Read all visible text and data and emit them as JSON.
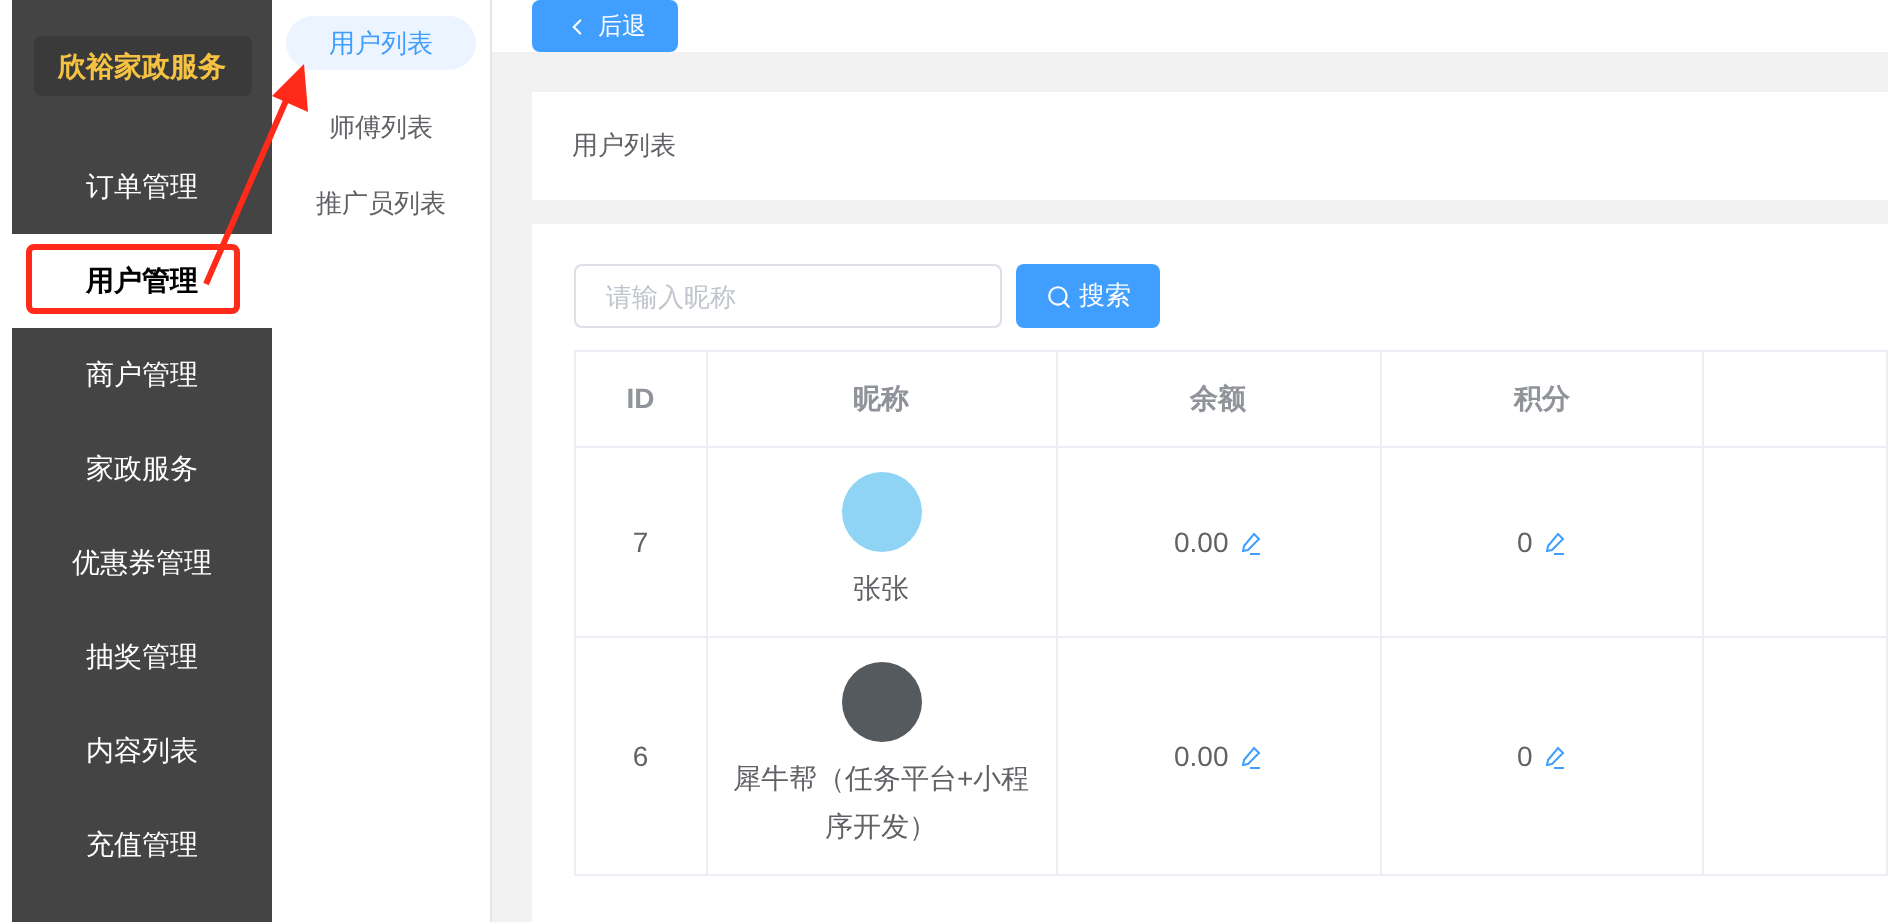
{
  "sidebar": {
    "brand": "欣裕家政服务",
    "items": [
      {
        "label": "订单管理",
        "selected": false
      },
      {
        "label": "用户管理",
        "selected": true
      },
      {
        "label": "商户管理",
        "selected": false
      },
      {
        "label": "家政服务",
        "selected": false
      },
      {
        "label": "优惠券管理",
        "selected": false
      },
      {
        "label": "抽奖管理",
        "selected": false
      },
      {
        "label": "内容列表",
        "selected": false
      },
      {
        "label": "充值管理",
        "selected": false
      }
    ]
  },
  "submenu": [
    {
      "label": "用户列表",
      "selected": true
    },
    {
      "label": "师傅列表",
      "selected": false
    },
    {
      "label": "推广员列表",
      "selected": false
    }
  ],
  "back_button": "后退",
  "page_title": "用户列表",
  "search": {
    "placeholder": "请输入昵称",
    "button": "搜索"
  },
  "table": {
    "columns": [
      "ID",
      "昵称",
      "余额",
      "积分"
    ],
    "rows": [
      {
        "id": "7",
        "nickname": "张张",
        "balance": "0.00",
        "points": "0"
      },
      {
        "id": "6",
        "nickname": "犀牛帮（任务平台+小程序开发）",
        "balance": "0.00",
        "points": "0"
      }
    ]
  }
}
